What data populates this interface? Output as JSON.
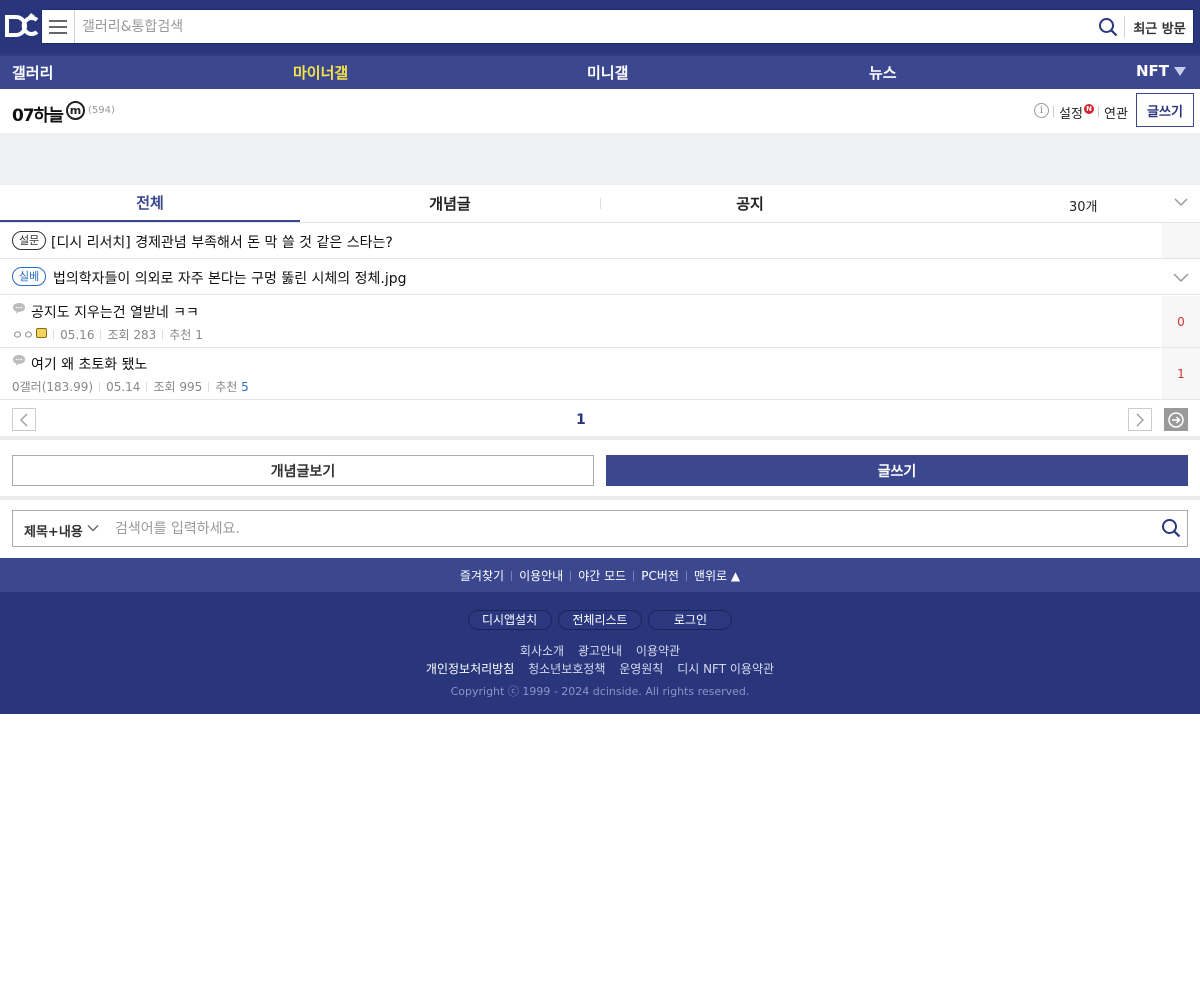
{
  "header": {
    "logo": "dc",
    "search_placeholder": "갤러리&통합검색",
    "recent_label": "최근 방문"
  },
  "nav": {
    "items": [
      {
        "label": "갤러리"
      },
      {
        "label": "마이너갤"
      },
      {
        "label": "미니갤"
      },
      {
        "label": "뉴스"
      },
      {
        "label": "NFT"
      }
    ],
    "active_color": "#f6e44a"
  },
  "gallery": {
    "title": "07하늘",
    "type_badge": "m",
    "count": "(594)",
    "info": "i",
    "settings": "설정",
    "new_badge": "N",
    "related": "연관",
    "write": "글쓰기"
  },
  "tabs": {
    "items": [
      {
        "label": "전체"
      },
      {
        "label": "개념글"
      },
      {
        "label": "공지"
      }
    ],
    "count_select": "30개"
  },
  "notices": [
    {
      "badge": "설문",
      "text": "[디시 리서치] 경제관념 부족해서 돈 막 쓸 것 같은 스타는?"
    },
    {
      "badge": "실베",
      "text": "법의학자들이 의외로 자주 본다는 구멍 뚫린 시체의 정체.jpg"
    }
  ],
  "posts": [
    {
      "title": "공지도 지우는건 열받네 ㅋㅋ",
      "author": "ㅇㅇ",
      "date": "05.16",
      "views": "조회 283",
      "recommend_label": "추천",
      "recommend": "1",
      "comments": "0"
    },
    {
      "title": "여기 왜 초토화 됐노",
      "author": "0갤러(183.99)",
      "date": "05.14",
      "views": "조회 995",
      "recommend_label": "추천",
      "recommend": "5",
      "comments": "1"
    }
  ],
  "pagination": {
    "current": "1"
  },
  "actions": {
    "concept": "개념글보기",
    "write": "글쓰기"
  },
  "bottom_search": {
    "type": "제목+내용",
    "placeholder": "검색어를 입력하세요."
  },
  "footer": {
    "links": [
      "즐겨찾기",
      "이용안내",
      "야간 모드",
      "PC버전",
      "맨위로 ▲"
    ],
    "buttons": [
      "디시앱설치",
      "전체리스트",
      "로그인"
    ],
    "row1": [
      "회사소개",
      "광고안내",
      "이용약관"
    ],
    "row2": [
      "개인정보처리방침",
      "청소년보호정책",
      "운영원칙",
      "디시 NFT 이용약관"
    ],
    "copyright": "Copyright ⓒ 1999 - 2024 dcinside. All rights reserved."
  },
  "colors": {
    "brand": "#29367c",
    "nav": "#3b4890",
    "accent_link": "#2a6cc4"
  }
}
